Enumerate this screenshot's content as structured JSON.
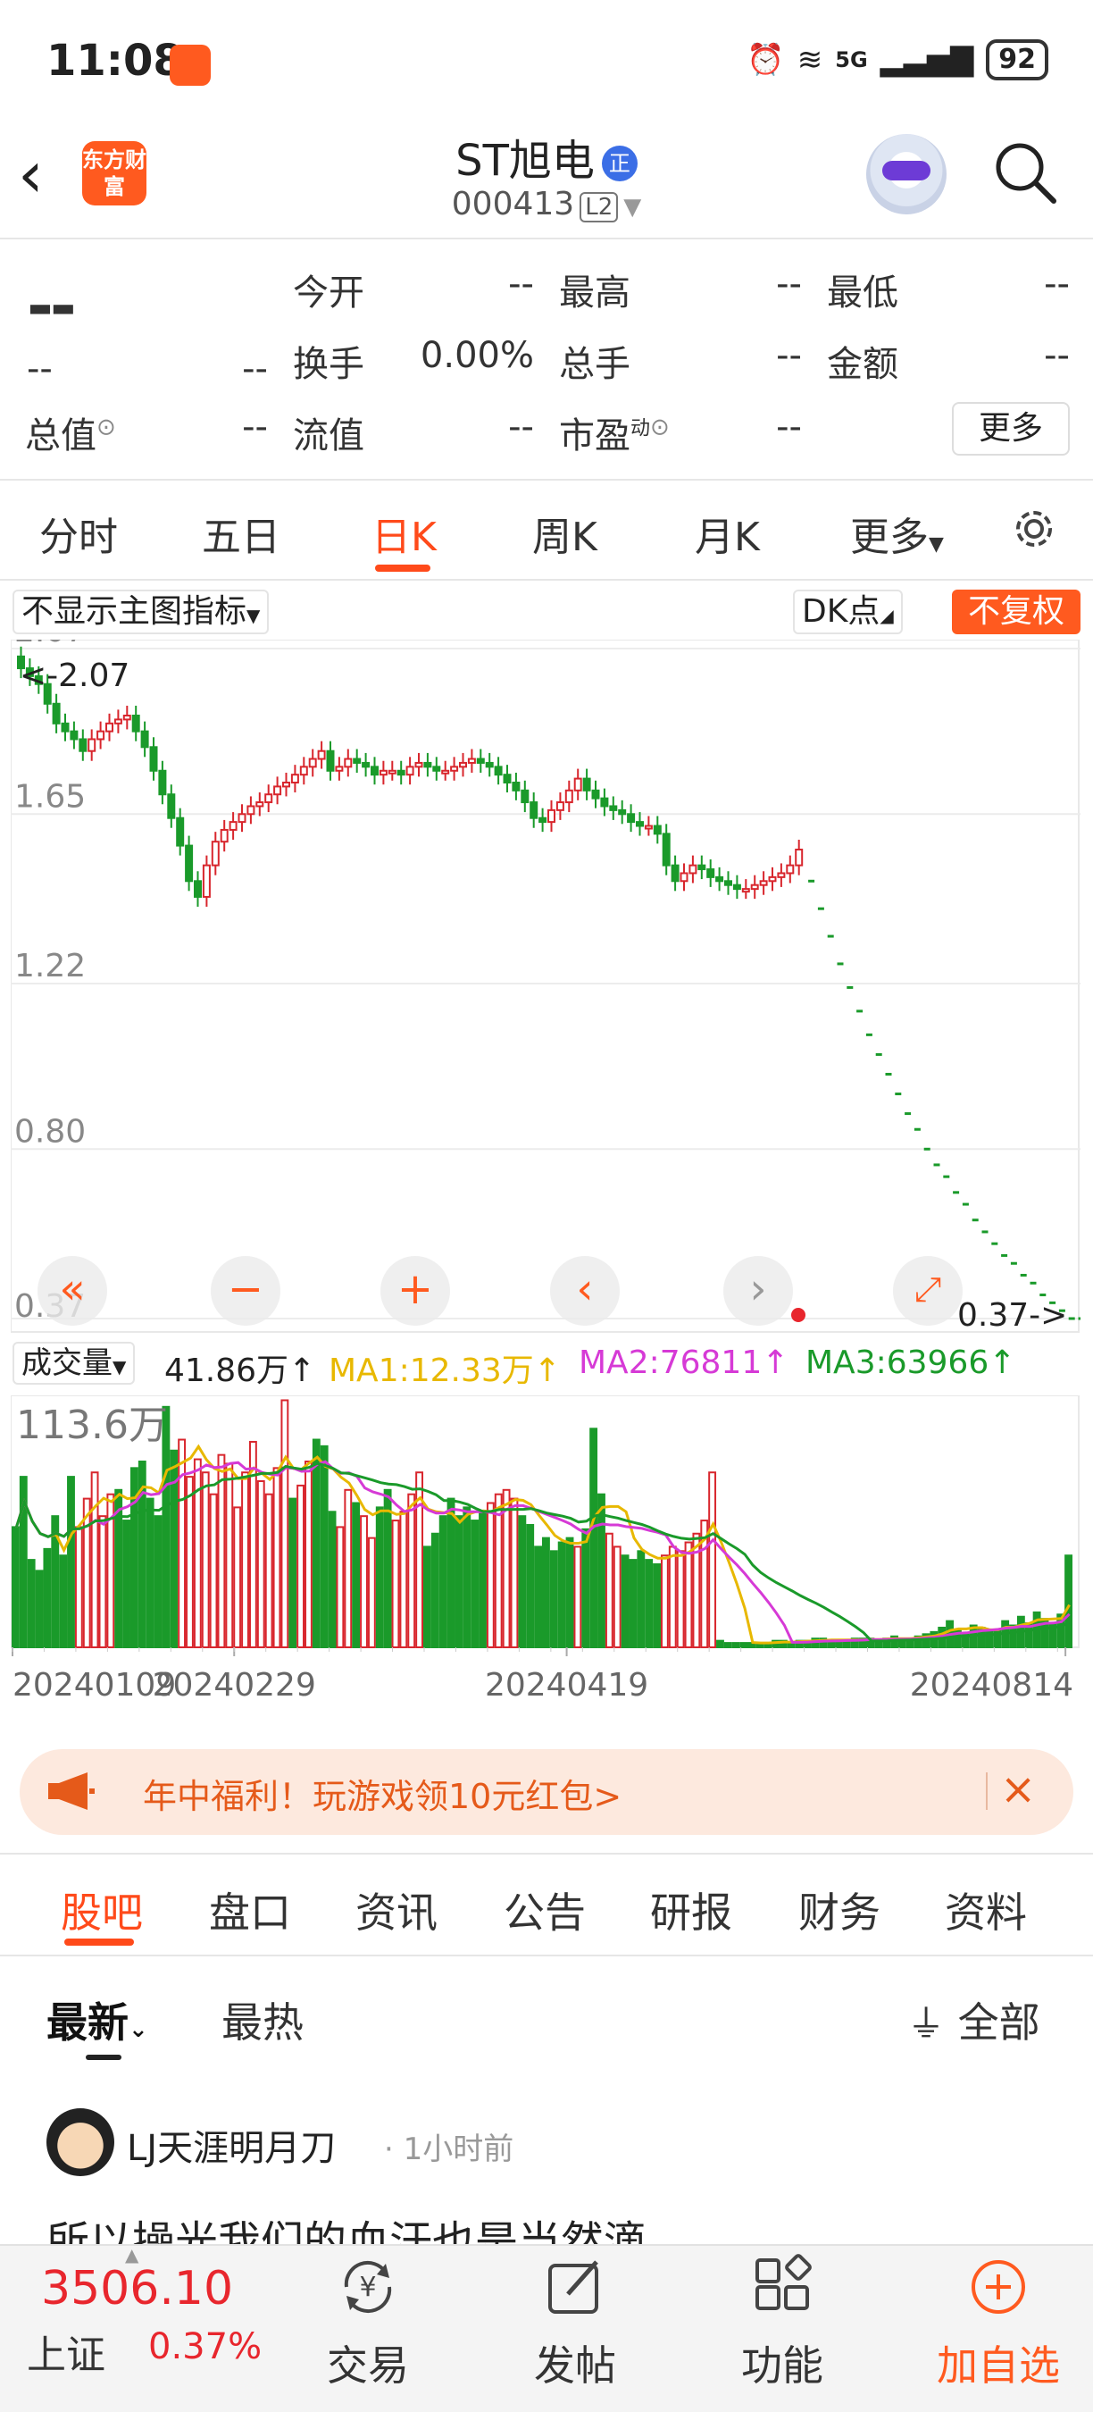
{
  "status": {
    "time": "11:08",
    "network": "5G",
    "battery": "92"
  },
  "header": {
    "brand_logo": "东方财富",
    "stock_name": "ST旭电",
    "stock_badge": "正",
    "stock_code": "000413",
    "level_tag": "L2"
  },
  "quote": {
    "price": "--",
    "change": "--",
    "change_pct": "--",
    "total_value_label": "总值",
    "total_value": "--",
    "fields": [
      {
        "label": "今开",
        "value": "--"
      },
      {
        "label": "最高",
        "value": "--"
      },
      {
        "label": "最低",
        "value": "--"
      },
      {
        "label": "换手",
        "value": "0.00%"
      },
      {
        "label": "总手",
        "value": "--"
      },
      {
        "label": "金额",
        "value": "--"
      },
      {
        "label": "流值",
        "value": "--"
      },
      {
        "label": "市盈",
        "value": "--"
      }
    ],
    "pe_superscript": "动",
    "more_button": "更多"
  },
  "chart_tabs": [
    {
      "label": "分时",
      "active": false
    },
    {
      "label": "五日",
      "active": false
    },
    {
      "label": "日K",
      "active": true
    },
    {
      "label": "周K",
      "active": false
    },
    {
      "label": "月K",
      "active": false
    },
    {
      "label": "更多",
      "active": false
    }
  ],
  "chart_controls": {
    "indicator_select": "不显示主图指标",
    "dk_select": "DK点",
    "adjust_button": "不复权"
  },
  "volume_legend": {
    "select": "成交量",
    "vol": "41.86万↑",
    "ma1": "MA1:12.33万↑",
    "ma2": "MA2:76811↑",
    "ma3": "MA3:63966↑"
  },
  "chart_data": [
    {
      "type": "candlestick",
      "y_ticks": [
        "2.07",
        "1.65",
        "1.22",
        "0.80",
        "0.37"
      ],
      "ylim": [
        0.37,
        2.07
      ],
      "annotations": {
        "high_marker": "<-2.07",
        "low_marker": "0.37->"
      },
      "x_ticks": [
        "20240109",
        "20240229",
        "20240419",
        "20240814"
      ],
      "close_pre": [
        2.02,
        2.0,
        1.98,
        1.93,
        1.88,
        1.86,
        1.84,
        1.81,
        1.84,
        1.86,
        1.88,
        1.89,
        1.9,
        1.86,
        1.82,
        1.76,
        1.7,
        1.64,
        1.57,
        1.48,
        1.44,
        1.52,
        1.58,
        1.61,
        1.63,
        1.65,
        1.67,
        1.68,
        1.7,
        1.72,
        1.73,
        1.75,
        1.77,
        1.79,
        1.81,
        1.76,
        1.77,
        1.79,
        1.78,
        1.77,
        1.75,
        1.76,
        1.76,
        1.75,
        1.77,
        1.78,
        1.77,
        1.76,
        1.76,
        1.77,
        1.78,
        1.79,
        1.78,
        1.77,
        1.75,
        1.73,
        1.71,
        1.68,
        1.64,
        1.63,
        1.66,
        1.68,
        1.71,
        1.74,
        1.71,
        1.69,
        1.67,
        1.66,
        1.65,
        1.63,
        1.62,
        1.62,
        1.6,
        1.52,
        1.48,
        1.5,
        1.52,
        1.51,
        1.49,
        1.48,
        1.47,
        1.46,
        1.46,
        1.47,
        1.48,
        1.49,
        1.5,
        1.52,
        1.56
      ],
      "close_limit_down": [
        1.48,
        1.41,
        1.34,
        1.27,
        1.21,
        1.15,
        1.09,
        1.04,
        0.99,
        0.94,
        0.89,
        0.85,
        0.8,
        0.76,
        0.73,
        0.69,
        0.66,
        0.62,
        0.59,
        0.56,
        0.53,
        0.51,
        0.48,
        0.46,
        0.43,
        0.41,
        0.39,
        0.37,
        0.37
      ],
      "volume_ylim": [
        0,
        113.6
      ],
      "volume_top_label": "113.6万",
      "volume_pre": [
        55,
        78,
        40,
        35,
        45,
        60,
        42,
        78,
        55,
        68,
        80,
        60,
        70,
        72,
        58,
        82,
        85,
        68,
        60,
        110,
        90,
        95,
        78,
        86,
        80,
        70,
        88,
        84,
        64,
        80,
        94,
        76,
        70,
        82,
        113,
        68,
        74,
        85,
        95,
        92,
        62,
        55,
        72,
        66,
        60,
        50,
        64,
        72,
        58,
        62,
        70,
        80,
        46,
        52,
        60,
        68,
        60,
        64,
        58,
        62,
        66,
        70,
        72,
        68,
        60,
        56,
        46,
        50,
        44,
        48,
        50,
        46,
        54,
        100,
        70,
        52,
        46,
        42,
        40,
        44,
        40,
        38,
        42,
        46,
        44,
        48,
        52,
        58,
        80
      ],
      "volume_post": [
        3,
        2,
        2,
        2,
        2,
        2,
        2,
        3,
        3,
        2,
        3,
        3,
        4,
        4,
        3,
        3,
        3,
        4,
        4,
        4,
        3,
        4,
        5,
        4,
        4,
        5,
        6,
        7,
        9,
        12,
        8,
        6,
        10,
        9,
        7,
        8,
        12,
        10,
        14,
        11,
        16,
        13,
        11,
        15,
        42
      ]
    }
  ],
  "promo": {
    "text": "年中福利！玩游戏领10元红包>",
    "close": "×"
  },
  "section_tabs": [
    "股吧",
    "盘口",
    "资讯",
    "公告",
    "研报",
    "财务",
    "资料"
  ],
  "sort_tabs": {
    "latest": "最新",
    "hot": "最热",
    "filter": "全部"
  },
  "post": {
    "user": "LJ天涯明月刀",
    "time": "· 1小时前",
    "text": "所以操光我们的血汗也是当然滴"
  },
  "bottom_bar": {
    "index_value": "3506.10",
    "index_name": "上证",
    "index_pct": "0.37%",
    "nav": [
      {
        "label": "交易",
        "icon": "yen-exchange-icon"
      },
      {
        "label": "发帖",
        "icon": "compose-icon"
      },
      {
        "label": "功能",
        "icon": "grid-icon"
      },
      {
        "label": "加自选",
        "icon": "add-circle-icon"
      }
    ]
  },
  "colors": {
    "accent": "#ff5a1f",
    "up": "#d8262d",
    "down": "#1a9a2a",
    "ma1": "#e8b800",
    "ma2": "#d63ad6",
    "ma3": "#1a9a2a"
  }
}
